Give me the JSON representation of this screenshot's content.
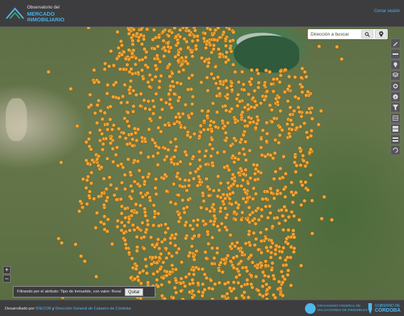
{
  "header": {
    "logo_line1": "Observatorio del",
    "logo_line2": "MERCADO",
    "logo_line3": "INMOBILIARIO",
    "logout_label": "Cerrar sesión"
  },
  "search": {
    "placeholder": "Dirección a buscar",
    "icons": [
      "search-icon",
      "location-pin-icon"
    ]
  },
  "toolbar": {
    "tools": [
      "pencil-icon",
      "ruler-icon",
      "location-marker-icon",
      "layers-icon",
      "settings-gear-icon",
      "info-icon",
      "filter-icon",
      "table-icon",
      "grid-icon",
      "layer-stack-icon",
      "refresh-icon"
    ]
  },
  "zoom": {
    "in_label": "+",
    "out_label": "–"
  },
  "filter": {
    "text": "Filtrando por el atributo: Tipo de Inmueble, con valor: Rural",
    "button_label": "Quitar"
  },
  "footer": {
    "prefix": "Desarrollado por ",
    "link1": "IDECOR",
    "mid": " y ",
    "link2": "Dirección General de Catastro de Córdoba",
    "ofevi_line1": "ORGANISMO FEDERAL DE",
    "ofevi_line2": "VALUACIONES DE INMUEBLES",
    "cba_line1": "GOBIERNO DE",
    "cba_line2": "CÓRDOBA"
  },
  "map": {
    "marker_color": "#f0a534",
    "accent": "#4fb7ea"
  }
}
